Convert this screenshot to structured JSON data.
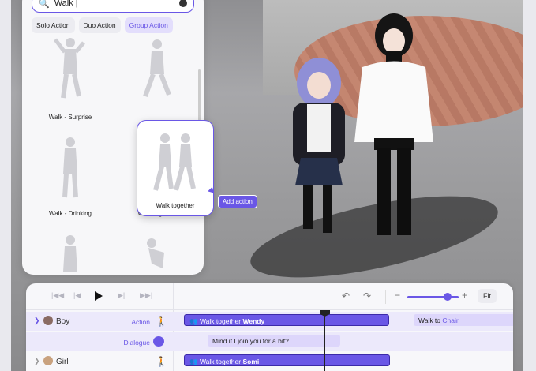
{
  "search": {
    "query": "Walk |"
  },
  "chips": [
    "Solo Action",
    "Duo Action",
    "Group Action"
  ],
  "active_chip": "Group Action",
  "actions": [
    {
      "label": "Walk - Surprise"
    },
    {
      "label": "Walk - Drinking"
    },
    {
      "label": "Walk together"
    }
  ],
  "drag_preview": {
    "label": "Walk together",
    "tag": "Add action"
  },
  "toolbar": {
    "fit": "Fit"
  },
  "tracks": [
    {
      "name": "Boy",
      "action_label": "Action",
      "dialogue_label": "Dialogue",
      "action_block_prefix": "Walk together",
      "action_block_partner": "Wendy",
      "next_block_prefix": "Walk to",
      "next_block_target": "Chair",
      "dialogue_text": "Mind if I join you for a bit?"
    },
    {
      "name": "Girl",
      "action_block_prefix": "Walk together",
      "action_block_partner": "Somi"
    }
  ],
  "colors": {
    "accent": "#6a57e6",
    "accent_light": "#ddd6fb"
  }
}
